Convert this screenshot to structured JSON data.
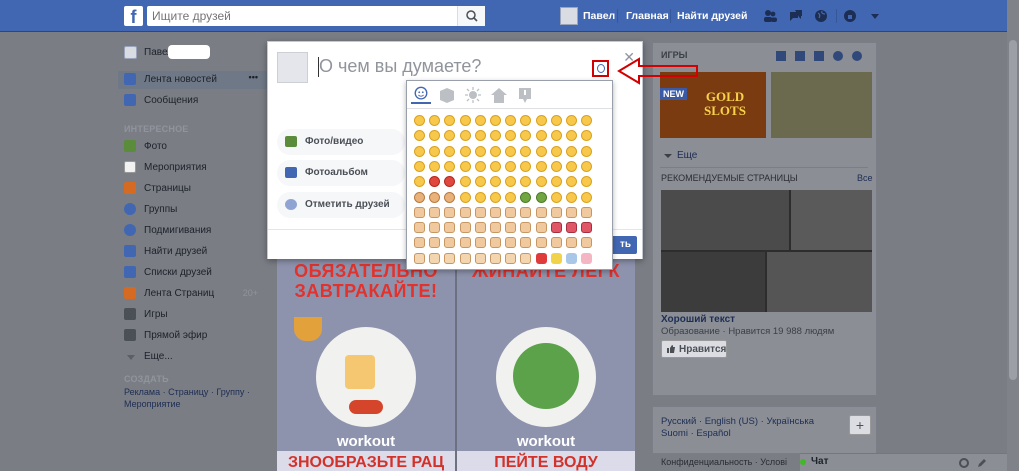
{
  "topbar": {
    "logo": "f",
    "search_placeholder": "Ищите друзей",
    "user_name": "Павел",
    "home": "Главная",
    "find_friends": "Найти друзей"
  },
  "left": {
    "profile_name": "Павел",
    "items_top": [
      {
        "label": "Лента новостей",
        "icon": "news-feed-icon",
        "color": "#4267b2"
      },
      {
        "label": "Сообщения",
        "icon": "messages-icon",
        "color": "#4267b2"
      }
    ],
    "section_interesting": "ИНТЕРЕСНОЕ",
    "items_interesting": [
      {
        "label": "Фото",
        "icon": "photo-icon",
        "color": "#5a8c3b",
        "count": ""
      },
      {
        "label": "Мероприятия",
        "icon": "calendar-icon",
        "color": "#b9b9b9",
        "count": ""
      },
      {
        "label": "Страницы",
        "icon": "flag-icon",
        "color": "#d56a22",
        "count": ""
      },
      {
        "label": "Группы",
        "icon": "groups-icon",
        "color": "#4267b2",
        "count": ""
      },
      {
        "label": "Подмигивания",
        "icon": "poke-icon",
        "color": "#4267b2",
        "count": ""
      },
      {
        "label": "Найти друзей",
        "icon": "find-friends-icon",
        "color": "#4267b2",
        "count": ""
      },
      {
        "label": "Списки друзей",
        "icon": "friend-lists-icon",
        "color": "#4267b2",
        "count": ""
      },
      {
        "label": "Лента Страниц",
        "icon": "pages-feed-icon",
        "color": "#d56a22",
        "count": "20+"
      },
      {
        "label": "Игры",
        "icon": "games-icon",
        "color": "#4b4f56",
        "count": ""
      },
      {
        "label": "Прямой эфир",
        "icon": "live-icon",
        "color": "#4b4f56",
        "count": ""
      },
      {
        "label": "Еще...",
        "icon": "chevron-down-icon",
        "color": "#90949c",
        "count": ""
      }
    ],
    "section_create": "СОЗДАТЬ",
    "create_line1": "Реклама · Страницу · Группу ·",
    "create_line2": "Мероприятие"
  },
  "feed": {
    "card1_head": "ОБЯЗАТЕЛЬНО ЗАВТРАКАЙТЕ!",
    "card1_brand": "workout",
    "card1_bottom": "ЗНООБРАЗЬТЕ РАЦ",
    "card2_head": "ЖИНАЙТЕ ЛЕГК",
    "card2_brand": "workout",
    "card2_bottom": "ПЕЙТЕ ВОДУ"
  },
  "composer": {
    "placeholder": "О чем вы думаете?",
    "options": [
      {
        "label": "Фото/видео",
        "icon": "photo-video-icon",
        "color": "#5a8c3b"
      },
      {
        "label": "Фотоальбом",
        "icon": "photo-album-icon",
        "color": "#4267b2"
      },
      {
        "label": "Отметить друзей",
        "icon": "tag-friends-icon",
        "color": "#4267b2"
      }
    ],
    "publish": "ть"
  },
  "right": {
    "games_title": "ИГРЫ",
    "game_badge": "NEW",
    "game_label": "GOLD SLOTS",
    "more": "Еще",
    "pages_title": "РЕКОМЕНДУЕМЫЕ СТРАНИЦЫ",
    "pages_all": "Все",
    "page_name": "Хороший текст",
    "page_desc": "Образование · Нравится 19 988 людям",
    "like_button": "Нравится",
    "langs_line1": "Русский · English (US) · Українська",
    "langs_line2": "Suomi · Español",
    "add_lang": "+",
    "footer_text": "Конфиденциальность · Услові",
    "chat": "Чат"
  },
  "colors": {
    "brand": "#4267b2",
    "annotation": "#d20000"
  }
}
